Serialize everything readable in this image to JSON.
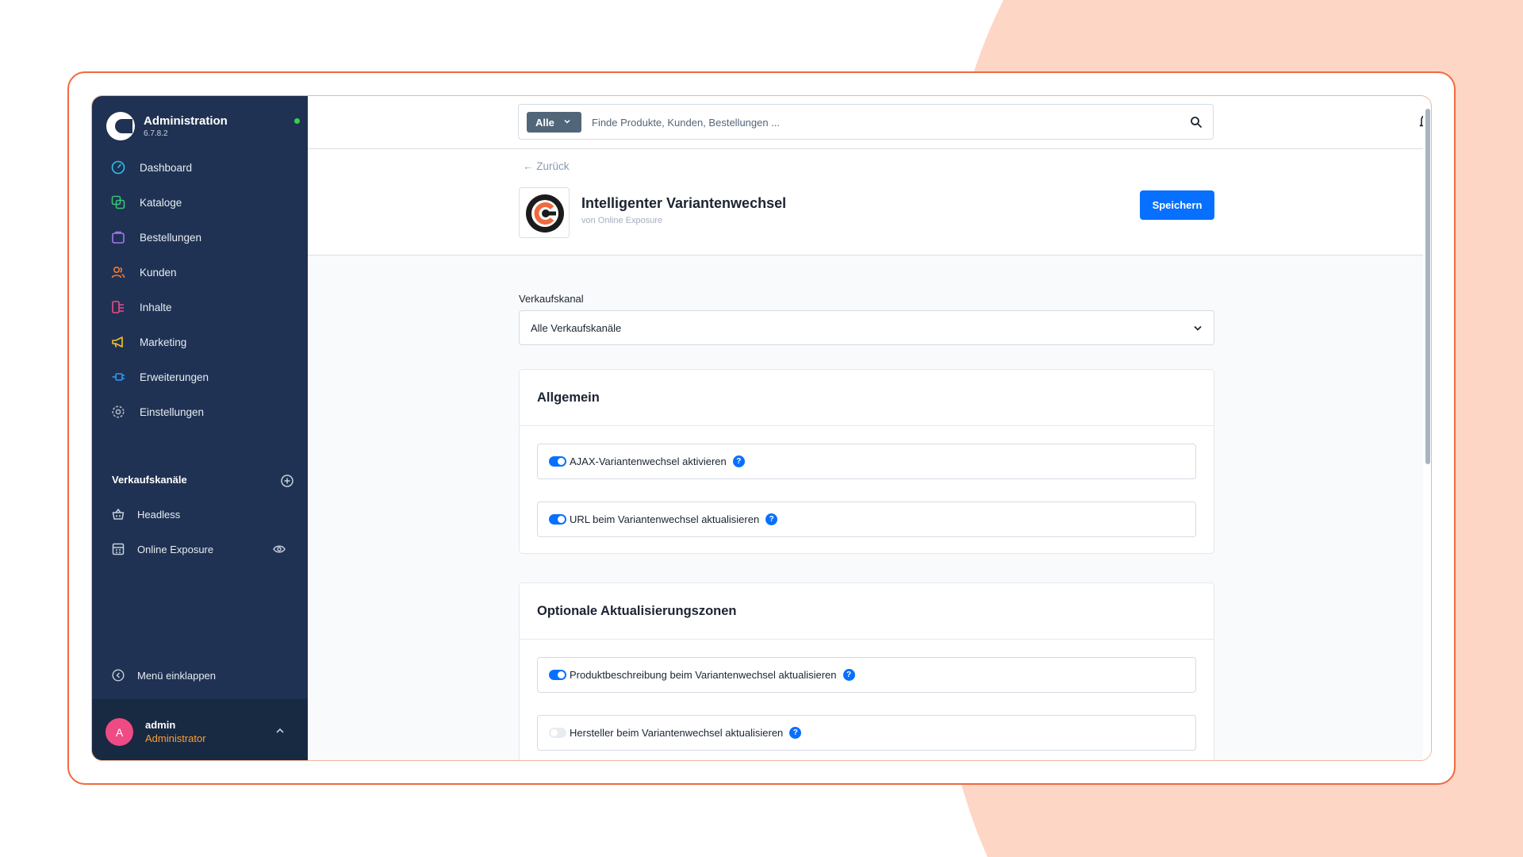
{
  "brand": {
    "title": "Administration",
    "version": "6.7.8.2"
  },
  "nav": {
    "items": [
      {
        "label": "Dashboard"
      },
      {
        "label": "Kataloge"
      },
      {
        "label": "Bestellungen"
      },
      {
        "label": "Kunden"
      },
      {
        "label": "Inhalte"
      },
      {
        "label": "Marketing"
      },
      {
        "label": "Erweiterungen"
      },
      {
        "label": "Einstellungen"
      }
    ],
    "icon_colors": [
      "#2ec1e6",
      "#38c272",
      "#a675ee",
      "#f07a3a",
      "#ec4b87",
      "#f8c223",
      "#2e9af7",
      "#aab4c2"
    ]
  },
  "sales_channels": {
    "heading": "Verkaufskanäle",
    "items": [
      {
        "label": "Headless"
      },
      {
        "label": "Online Exposure"
      }
    ]
  },
  "collapse_label": "Menü einklappen",
  "user": {
    "initial": "A",
    "name": "admin",
    "role": "Administrator"
  },
  "search": {
    "type": "Alle",
    "placeholder": "Finde Produkte, Kunden, Bestellungen ..."
  },
  "header": {
    "back": "← Zurück",
    "title": "Intelligenter Variantenwechsel",
    "vendor": "von Online Exposure",
    "save": "Speichern"
  },
  "sales_channel_field": {
    "label": "Verkaufskanal",
    "value": "Alle Verkaufskanäle"
  },
  "cards": [
    {
      "title": "Allgemein",
      "options": [
        {
          "label": "AJAX-Variantenwechsel aktivieren",
          "enabled": true
        },
        {
          "label": "URL beim Variantenwechsel aktualisieren",
          "enabled": true
        }
      ]
    },
    {
      "title": "Optionale Aktualisierungszonen",
      "options": [
        {
          "label": "Produktbeschreibung beim Variantenwechsel aktualisieren",
          "enabled": true
        },
        {
          "label": "Hersteller beim Variantenwechsel aktualisieren",
          "enabled": false
        }
      ]
    }
  ],
  "help_glyph": "?",
  "colors": {
    "accent": "#0870ff",
    "sidebar": "#1f3253",
    "frame": "#ef6a3f",
    "background_shape": "#fdd6c6"
  }
}
